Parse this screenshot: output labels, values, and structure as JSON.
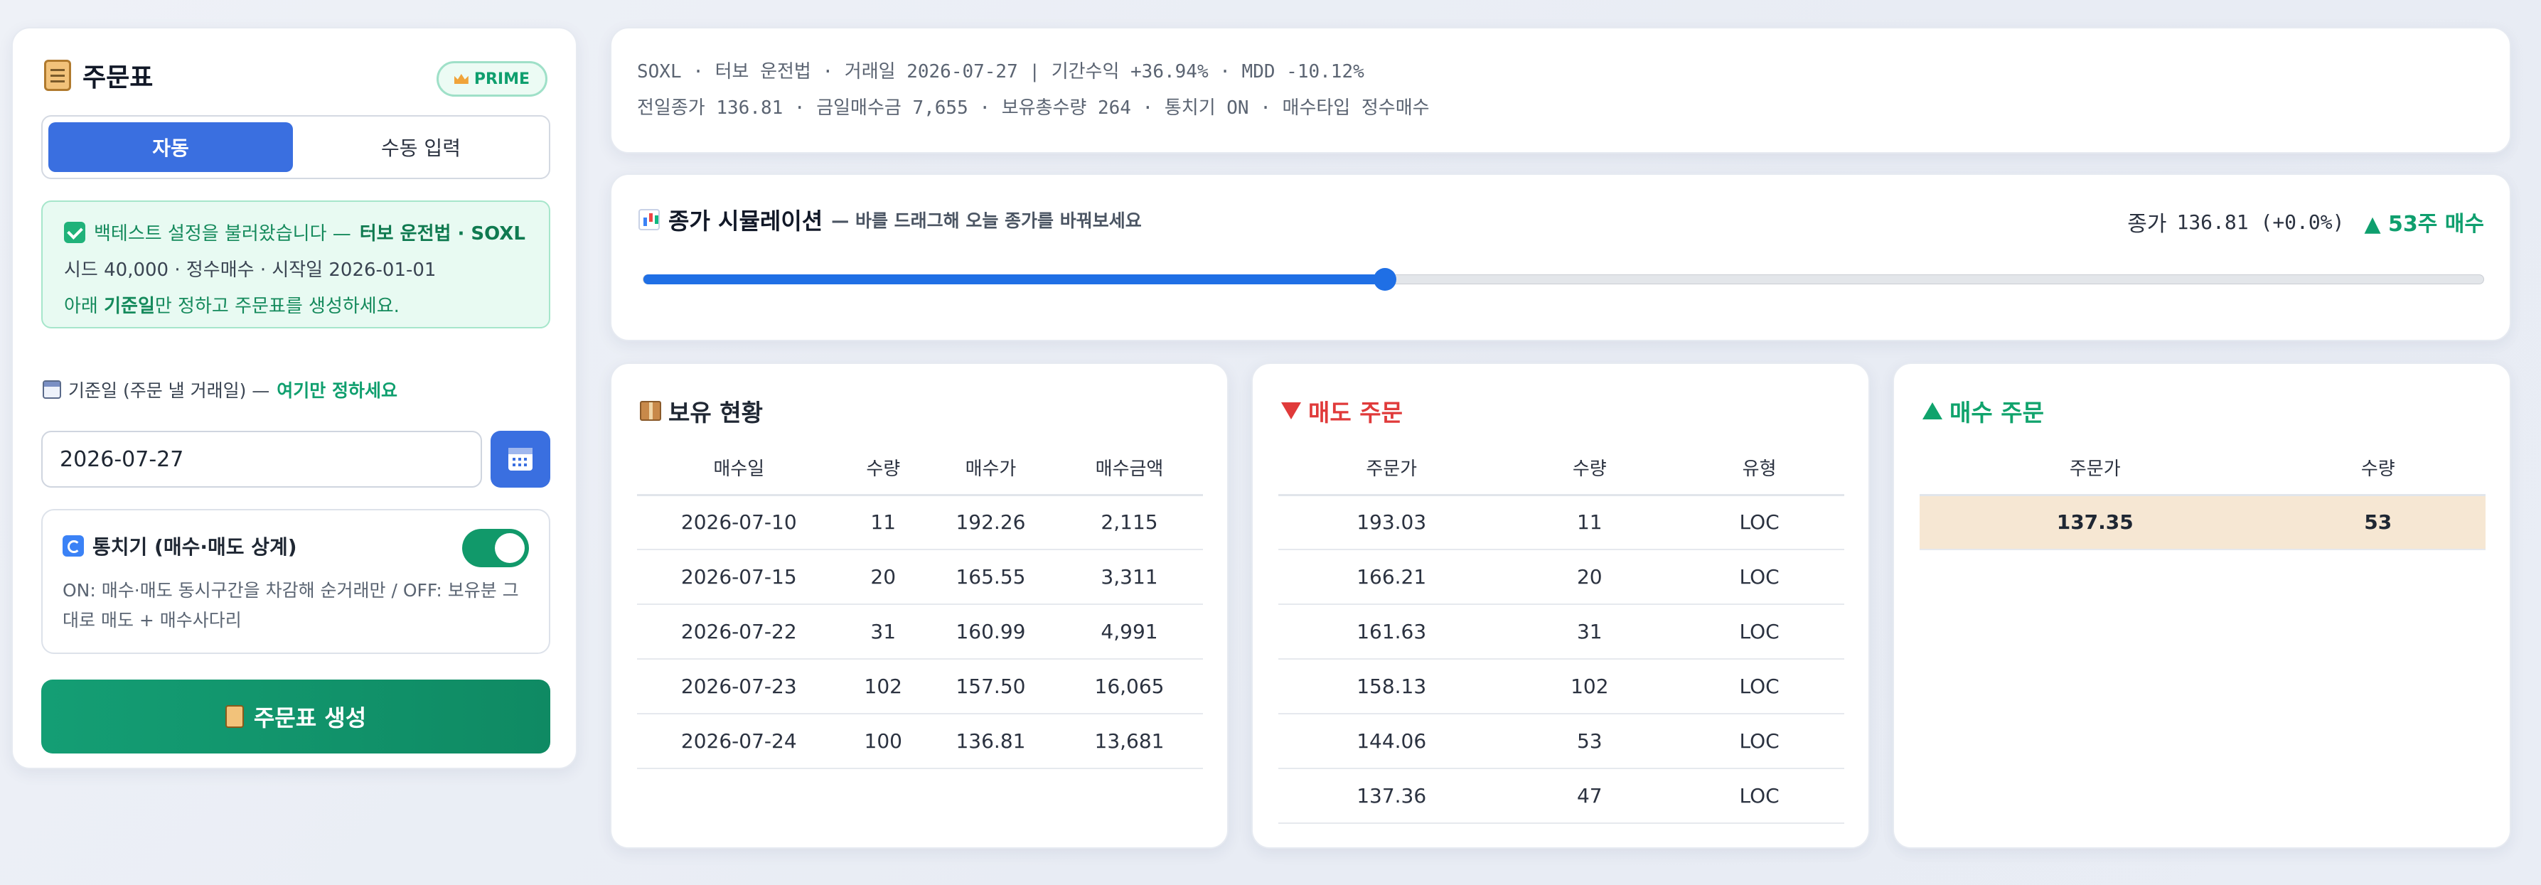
{
  "left_panel": {
    "title": "주문표",
    "badge": "PRIME",
    "mode_tabs": [
      "자동",
      "수동 입력"
    ],
    "notice": {
      "line1_prefix": "백테스트 설정을 불러왔습니다 —",
      "line1_bold": "터보 운전법 · SOXL",
      "line2": "시드 40,000 · 정수매수 · 시작일 2026-01-01",
      "line3_prefix": "아래",
      "line3_bold": "기준일",
      "line3_suffix": "만 정하고 주문표를 생성하세요."
    },
    "date_label_prefix": "기준일 (주문 낼 거래일) —",
    "date_label_bold": "여기만 정하세요",
    "date_value": "2026-07-27",
    "netting": {
      "title": "통치기 (매수·매도 상계)",
      "enabled": true,
      "description": "ON: 매수·매도 동시구간을 차감해 순거래만 / OFF: 보유분 그대로 매도 + 매수사다리"
    },
    "generate_label": "주문표 생성"
  },
  "info": {
    "line1": "SOXL · 터보 운전법 · 거래일 2026-07-27 | 기간수익 +36.94% · MDD -10.12%",
    "line2": "전일종가 136.81 · 금일매수금 7,655 · 보유총수량 264 · 통치기 ON · 매수타입 정수매수"
  },
  "simulation": {
    "title": "종가 시뮬레이션",
    "subtitle": "— 바를 드래그해 오늘 종가를 바꿔보세요",
    "close_label": "종가",
    "close_value": "136.81 (+0.0%)",
    "buy_summary": "▲ 53주 매수",
    "slider_fraction": 0.403
  },
  "holdings": {
    "title": "보유 현황",
    "columns": [
      "매수일",
      "수량",
      "매수가",
      "매수금액"
    ],
    "rows": [
      [
        "2026-07-10",
        "11",
        "192.26",
        "2,115"
      ],
      [
        "2026-07-15",
        "20",
        "165.55",
        "3,311"
      ],
      [
        "2026-07-22",
        "31",
        "160.99",
        "4,991"
      ],
      [
        "2026-07-23",
        "102",
        "157.50",
        "16,065"
      ],
      [
        "2026-07-24",
        "100",
        "136.81",
        "13,681"
      ]
    ]
  },
  "sell_orders": {
    "title": "매도 주문",
    "columns": [
      "주문가",
      "수량",
      "유형"
    ],
    "rows": [
      [
        "193.03",
        "11",
        "LOC"
      ],
      [
        "166.21",
        "20",
        "LOC"
      ],
      [
        "161.63",
        "31",
        "LOC"
      ],
      [
        "158.13",
        "102",
        "LOC"
      ],
      [
        "144.06",
        "53",
        "LOC"
      ],
      [
        "137.36",
        "47",
        "LOC"
      ]
    ]
  },
  "buy_orders": {
    "title": "매수 주문",
    "columns": [
      "주문가",
      "수량"
    ],
    "rows": [
      [
        "137.35",
        "53"
      ]
    ]
  },
  "colors": {
    "accent_blue": "#3a6fe0",
    "green": "#10a36c",
    "red": "#e03a3a"
  }
}
